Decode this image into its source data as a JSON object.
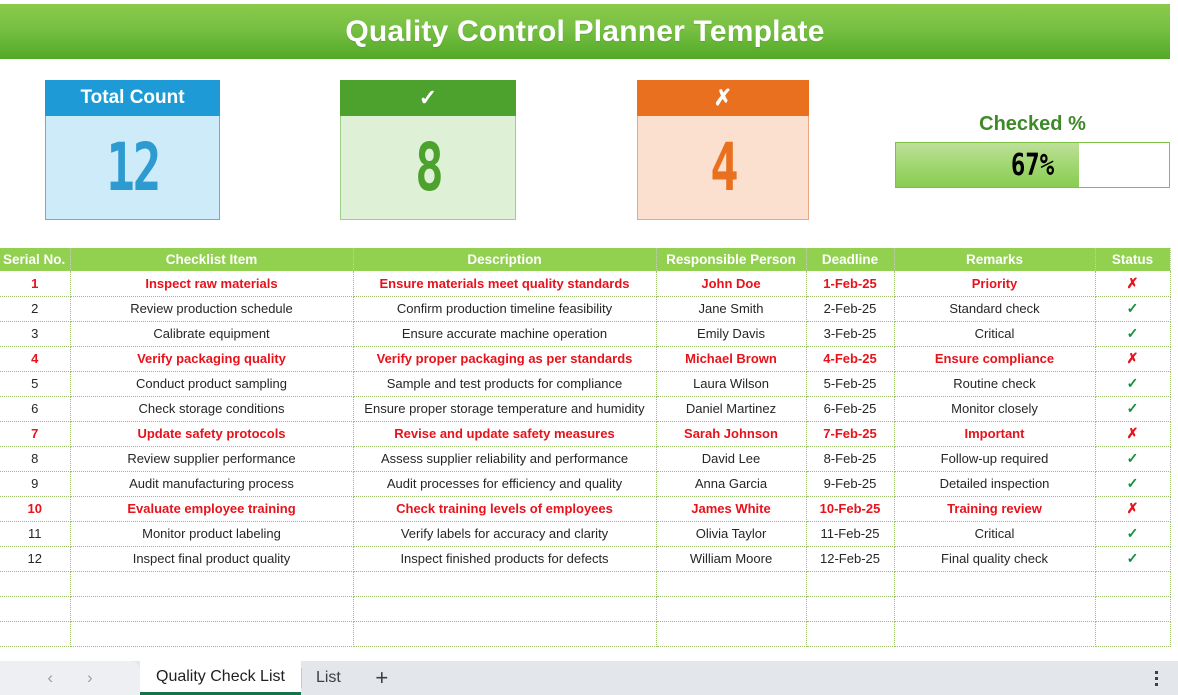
{
  "header": {
    "title": "Quality Control Planner Template",
    "bar_color": "#77C043",
    "text_color": "#FFFFFF"
  },
  "kpis": [
    {
      "id": "total-count",
      "label": "Total Count",
      "value": "12",
      "header_color": "#1E9BD7",
      "body_color": "#CDEBF9",
      "value_color": "#2E9BD0"
    },
    {
      "id": "checked-count",
      "label": "✓",
      "value": "8",
      "header_color": "#4CA22C",
      "body_color": "#DEF1D7",
      "value_color": "#4CA22C"
    },
    {
      "id": "unchecked-count",
      "label": "✗",
      "value": "4",
      "header_color": "#E8701F",
      "body_color": "#FBE0CF",
      "value_color": "#E8701F"
    }
  ],
  "gauge": {
    "label": "Checked %",
    "value_text": "67%",
    "percent": 67,
    "fill_color": "#A6D977",
    "border_color": "#7DC242",
    "label_color": "#3E8A28"
  },
  "table": {
    "header_color": "#92D050",
    "flag_color": "#E8121B",
    "check_color": "#148F3C",
    "columns": [
      "Serial No.",
      "Checklist Item",
      "Description",
      "Responsible Person",
      "Deadline",
      "Remarks",
      "Status"
    ],
    "rows": [
      {
        "serial": "1",
        "item": "Inspect raw materials",
        "description": "Ensure materials meet quality standards",
        "person": "John Doe",
        "deadline": "1-Feb-25",
        "remarks": "Priority",
        "status": "✗",
        "flagged": true
      },
      {
        "serial": "2",
        "item": "Review production schedule",
        "description": "Confirm production timeline feasibility",
        "person": "Jane Smith",
        "deadline": "2-Feb-25",
        "remarks": "Standard check",
        "status": "✓",
        "flagged": false
      },
      {
        "serial": "3",
        "item": "Calibrate equipment",
        "description": "Ensure accurate machine operation",
        "person": "Emily Davis",
        "deadline": "3-Feb-25",
        "remarks": "Critical",
        "status": "✓",
        "flagged": false
      },
      {
        "serial": "4",
        "item": "Verify packaging quality",
        "description": "Verify proper packaging as per standards",
        "person": "Michael Brown",
        "deadline": "4-Feb-25",
        "remarks": "Ensure compliance",
        "status": "✗",
        "flagged": true
      },
      {
        "serial": "5",
        "item": "Conduct product sampling",
        "description": "Sample and test products for compliance",
        "person": "Laura Wilson",
        "deadline": "5-Feb-25",
        "remarks": "Routine check",
        "status": "✓",
        "flagged": false
      },
      {
        "serial": "6",
        "item": "Check storage conditions",
        "description": "Ensure proper storage temperature and humidity",
        "person": "Daniel Martinez",
        "deadline": "6-Feb-25",
        "remarks": "Monitor closely",
        "status": "✓",
        "flagged": false
      },
      {
        "serial": "7",
        "item": "Update safety protocols",
        "description": "Revise and update safety measures",
        "person": "Sarah Johnson",
        "deadline": "7-Feb-25",
        "remarks": "Important",
        "status": "✗",
        "flagged": true
      },
      {
        "serial": "8",
        "item": "Review supplier performance",
        "description": "Assess supplier reliability and performance",
        "person": "David Lee",
        "deadline": "8-Feb-25",
        "remarks": "Follow-up required",
        "status": "✓",
        "flagged": false
      },
      {
        "serial": "9",
        "item": "Audit manufacturing process",
        "description": "Audit processes for efficiency and quality",
        "person": "Anna Garcia",
        "deadline": "9-Feb-25",
        "remarks": "Detailed inspection",
        "status": "✓",
        "flagged": false
      },
      {
        "serial": "10",
        "item": "Evaluate employee training",
        "description": "Check training levels of employees",
        "person": "James White",
        "deadline": "10-Feb-25",
        "remarks": "Training review",
        "status": "✗",
        "flagged": true
      },
      {
        "serial": "11",
        "item": "Monitor product labeling",
        "description": "Verify labels for accuracy and clarity",
        "person": "Olivia Taylor",
        "deadline": "11-Feb-25",
        "remarks": "Critical",
        "status": "✓",
        "flagged": false
      },
      {
        "serial": "12",
        "item": "Inspect final product quality",
        "description": "Inspect finished products for defects",
        "person": "William Moore",
        "deadline": "12-Feb-25",
        "remarks": "Final quality check",
        "status": "✓",
        "flagged": false
      },
      {
        "serial": "",
        "item": "",
        "description": "",
        "person": "",
        "deadline": "",
        "remarks": "",
        "status": "",
        "flagged": false
      },
      {
        "serial": "",
        "item": "",
        "description": "",
        "person": "",
        "deadline": "",
        "remarks": "",
        "status": "",
        "flagged": false
      },
      {
        "serial": "",
        "item": "",
        "description": "",
        "person": "",
        "deadline": "",
        "remarks": "",
        "status": "",
        "flagged": false
      }
    ]
  },
  "sheetbar": {
    "prev_icon": "‹",
    "next_icon": "›",
    "tabs": [
      {
        "label": "Quality Check List",
        "active": true
      },
      {
        "label": "List",
        "active": false
      }
    ],
    "add_label": "+",
    "menu_icon": "kebab-menu-icon"
  }
}
